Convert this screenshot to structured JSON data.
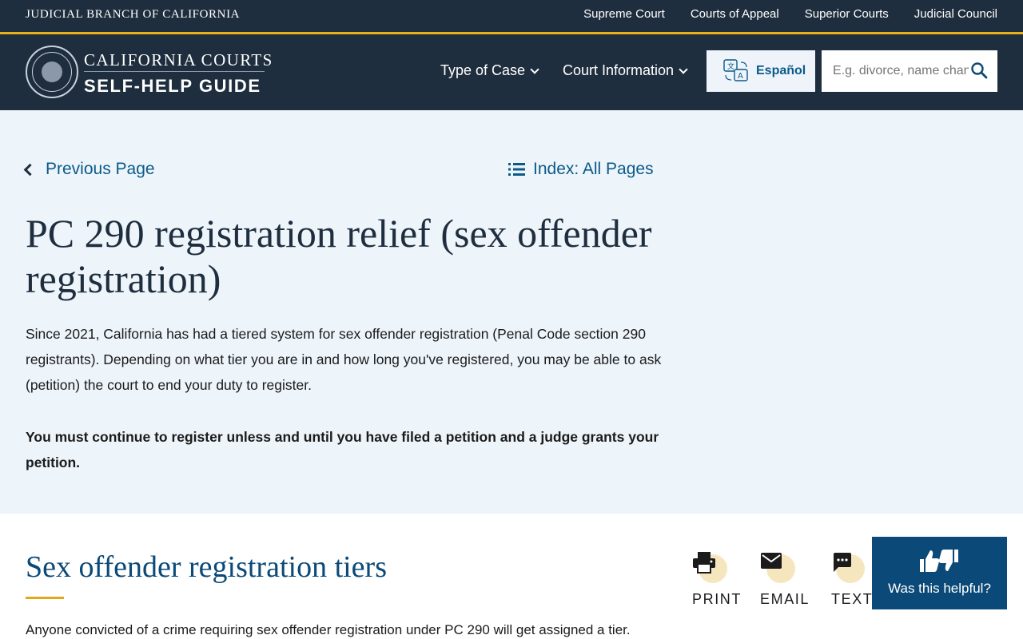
{
  "topbar": {
    "branch": "JUDICIAL BRANCH OF CALIFORNIA",
    "links": [
      "Supreme Court",
      "Courts of Appeal",
      "Superior Courts",
      "Judicial Council"
    ]
  },
  "header": {
    "brand_top": "CALIFORNIA COURTS",
    "brand_bottom": "SELF-HELP GUIDE",
    "nav": [
      "Type of Case",
      "Court Information"
    ],
    "language_button": "Español",
    "search_placeholder": "E.g. divorce, name change,"
  },
  "hero": {
    "previous_link": "Previous Page",
    "index_link": "Index: All Pages",
    "title": "PC 290 registration relief (sex offender registration)",
    "intro": "Since 2021, California has had a tiered system for sex offender registration (Penal Code section 290 registrants). Depending on what tier you are in and how long you've registered, you may be able to ask (petition) the court to end your duty to register.",
    "warning": "You must continue to register unless and until you have filed a petition and a judge grants your petition."
  },
  "section": {
    "title": "Sex offender registration tiers",
    "body": "Anyone convicted of a crime requiring sex offender registration under PC 290 will get assigned a tier."
  },
  "tools": {
    "print": "PRINT",
    "email": "EMAIL",
    "text": "TEXT"
  },
  "feedback": {
    "label": "Was this helpful?"
  },
  "colors": {
    "navy": "#1f2e3e",
    "gold": "#e8b119",
    "link_blue": "#0b5a8a",
    "hero_bg": "#edf4fa"
  }
}
